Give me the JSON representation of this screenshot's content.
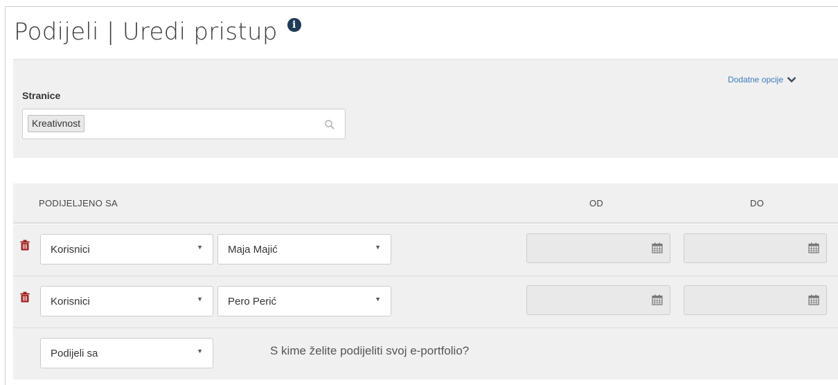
{
  "header": {
    "title": "Podijeli | Uredi pristup",
    "info_icon": "info-circle-icon"
  },
  "pages_panel": {
    "more_options_label": "Dodatne opcije",
    "pages_label": "Stranice",
    "selected_page": "Kreativnost",
    "search_icon": "search-icon"
  },
  "share_table": {
    "columns": {
      "shared_with": "PODIJELJENO SA",
      "from": "OD",
      "to": "DO"
    },
    "rows": [
      {
        "type": "Korisnici",
        "user": "Maja Majić",
        "from": "",
        "to": ""
      },
      {
        "type": "Korisnici",
        "user": "Pero Perić",
        "from": "",
        "to": ""
      }
    ],
    "add_share": {
      "select_value": "Podijeli sa",
      "question": "S kime želite podijeliti svoj e-portfolio?"
    }
  },
  "colors": {
    "panel_bg": "#f0f0f0",
    "link": "#3a7bbf",
    "delete_icon": "#a01c1c",
    "info_icon_bg": "#1f3a56"
  }
}
